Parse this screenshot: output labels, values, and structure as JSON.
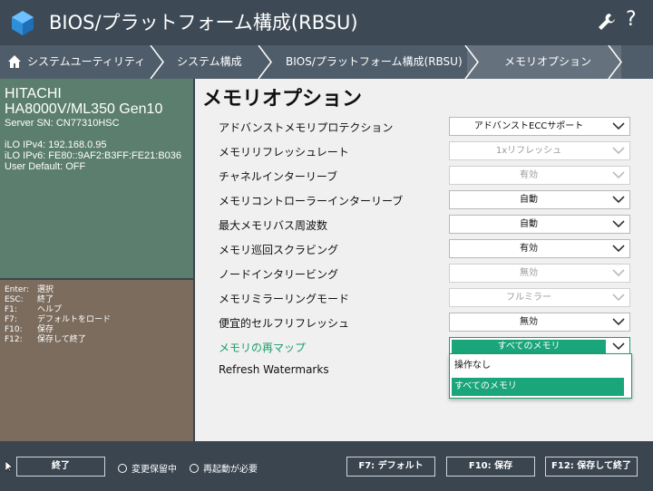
{
  "header": {
    "title": "BIOS/プラットフォーム構成(RBSU)",
    "help_label": "?"
  },
  "breadcrumb": {
    "items": [
      "システムユーティリティ",
      "システム構成",
      "BIOS/プラットフォーム構成(RBSU)",
      "メモリオプション"
    ]
  },
  "server": {
    "vendor": "HITACHI",
    "model": "HA8000V/ML350 Gen10",
    "serial": "Server SN: CN77310HSC",
    "ilo_ipv4": "iLO IPv4: 192.168.0.95",
    "ilo_ipv6": "iLO IPv6: FE80::9AF2:B3FF:FE21:B036",
    "user_default": "User Default: OFF"
  },
  "keys": [
    {
      "key": "Enter:",
      "action": "選択"
    },
    {
      "key": "ESC:",
      "action": "終了"
    },
    {
      "key": "F1:",
      "action": "ヘルプ"
    },
    {
      "key": "F7:",
      "action": "デフォルトをロード"
    },
    {
      "key": "F10:",
      "action": "保存"
    },
    {
      "key": "F12:",
      "action": "保存して終了"
    }
  ],
  "page_title": "メモリオプション",
  "settings": [
    {
      "label": "アドバンストメモリプロテクション",
      "value": "アドバンストECCサポート",
      "disabled": false
    },
    {
      "label": "メモリリフレッシュレート",
      "value": "1xリフレッシュ",
      "disabled": true
    },
    {
      "label": "チャネルインターリーブ",
      "value": "有効",
      "disabled": true
    },
    {
      "label": "メモリコントローラーインターリーブ",
      "value": "自動",
      "disabled": false
    },
    {
      "label": "最大メモリバス周波数",
      "value": "自動",
      "disabled": false
    },
    {
      "label": "メモリ巡回スクラビング",
      "value": "有効",
      "disabled": false
    },
    {
      "label": "ノードインタリービング",
      "value": "無効",
      "disabled": true
    },
    {
      "label": "メモリミラーリングモード",
      "value": "フルミラー",
      "disabled": true
    },
    {
      "label": "便宜的セルフリフレッシュ",
      "value": "無効",
      "disabled": false
    },
    {
      "label": "メモリの再マップ",
      "value": "すべてのメモリ",
      "disabled": false
    }
  ],
  "refresh_watermarks_label": "Refresh Watermarks",
  "dropdown_options": [
    "操作なし",
    "すべてのメモリ"
  ],
  "footer": {
    "exit_label": "終了",
    "pending_changes_label": "変更保留中",
    "reboot_required_label": "再起動が必要",
    "f7_label": "F7: デフォルト",
    "f10_label": "F10: 保存",
    "f12_label": "F12: 保存して終了"
  },
  "colors": {
    "accent": "#1aa57a",
    "header": "#3d4a56",
    "info_panel": "#5b7e6f",
    "keys_panel": "#7b6c5d"
  }
}
